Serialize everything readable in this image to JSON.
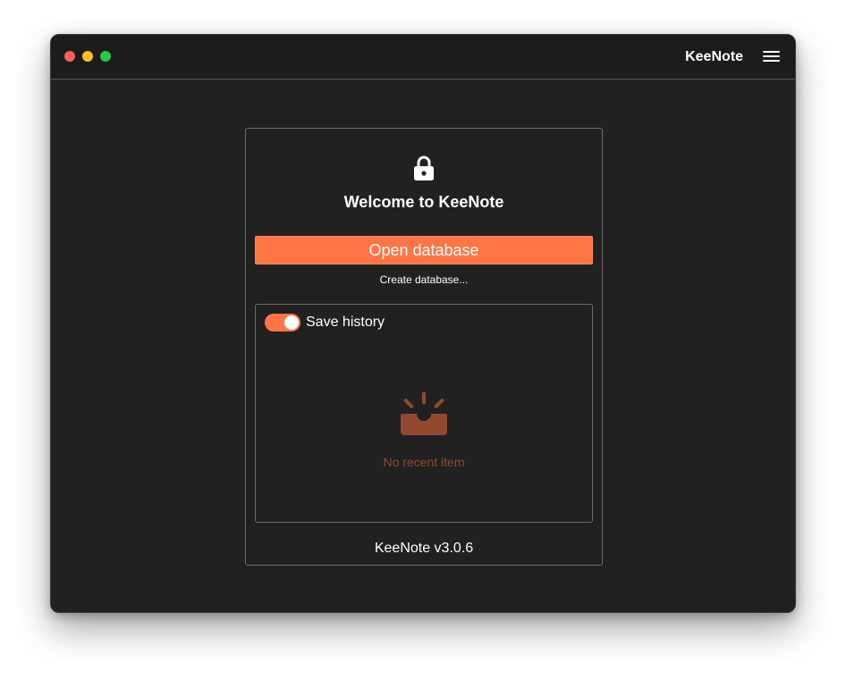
{
  "window": {
    "title": "KeeNote",
    "background_color": "#212121",
    "titlebar_color": "#1c1c1c"
  },
  "titlebar": {
    "traffic_lights": {
      "close_color": "#fe5f57",
      "minimize_color": "#febc2e",
      "zoom_color": "#28c840"
    },
    "menu_icon": "hamburger-menu-icon"
  },
  "welcome": {
    "icon": "lock-icon",
    "title": "Welcome to KeeNote",
    "open_button_label": "Open database",
    "create_link_label": "Create database..."
  },
  "history": {
    "toggle_label": "Save history",
    "toggle_on": true,
    "empty_icon": "empty-inbox-icon",
    "empty_text": "No recent item"
  },
  "footer": {
    "version": "KeeNote v3.0.6"
  },
  "colors": {
    "accent": "#ff7546",
    "empty_state": "#93492f"
  }
}
